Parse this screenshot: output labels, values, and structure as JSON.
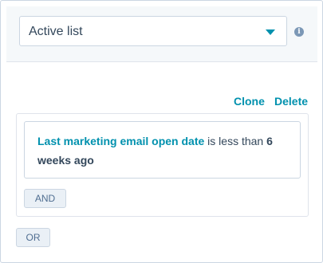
{
  "select": {
    "value": "Active list"
  },
  "info": {
    "glyph": "i"
  },
  "actions": {
    "clone_label": "Clone",
    "delete_label": "Delete"
  },
  "filter": {
    "property": "Last marketing email open date",
    "operator": " is less than ",
    "value_number": "6",
    "value_unit": "weeks ago"
  },
  "buttons": {
    "and_label": "AND",
    "or_label": "OR"
  },
  "colors": {
    "accent": "#0091ae",
    "text": "#33475b",
    "border": "#cbd6e2",
    "panel_bg": "#f5f8fa",
    "button_bg": "#eaf0f6"
  }
}
